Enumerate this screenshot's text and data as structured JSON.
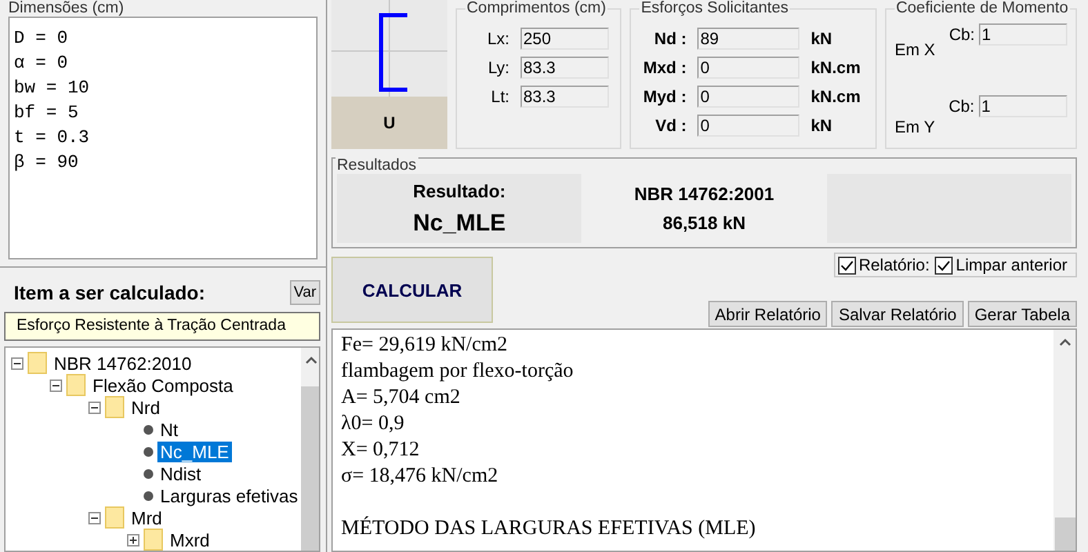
{
  "dimensions": {
    "title": "Dimensões (cm)",
    "lines": [
      "D = 0",
      "α = 0",
      "bw = 10",
      "bf = 5",
      "t = 0.3",
      "β = 90"
    ]
  },
  "item_panel": {
    "title": "Item a ser calculado:",
    "var_button": "Var",
    "description": "Esforço Resistente à Tração Centrada"
  },
  "tree": [
    {
      "label": "NBR 14762:2010",
      "kind": "folder",
      "expanded": true,
      "selected": false,
      "children": [
        {
          "label": "Flexão Composta",
          "kind": "folder",
          "expanded": true,
          "selected": false,
          "children": [
            {
              "label": "Nrd",
              "kind": "folder",
              "expanded": true,
              "selected": false,
              "children": [
                {
                  "label": "Nt",
                  "kind": "leaf",
                  "selected": false
                },
                {
                  "label": "Nc_MLE",
                  "kind": "leaf",
                  "selected": true
                },
                {
                  "label": "Ndist",
                  "kind": "leaf",
                  "selected": false
                },
                {
                  "label": "Larguras efetivas",
                  "kind": "leaf",
                  "selected": false
                }
              ]
            },
            {
              "label": "Mrd",
              "kind": "folder",
              "expanded": true,
              "selected": false,
              "children": [
                {
                  "label": "Mxrd",
                  "kind": "folder",
                  "expanded": false,
                  "selected": false
                }
              ]
            }
          ]
        }
      ]
    }
  ],
  "shape": {
    "label": "U"
  },
  "lengths": {
    "title": "Comprimentos (cm)",
    "fields": [
      {
        "label": "Lx:",
        "value": "250"
      },
      {
        "label": "Ly:",
        "value": "83.3"
      },
      {
        "label": "Lt:",
        "value": "83.3"
      }
    ]
  },
  "forces": {
    "title": "Esforços Solicitantes",
    "fields": [
      {
        "label": "Nd :",
        "value": "89",
        "unit": "kN"
      },
      {
        "label": "Mxd :",
        "value": "0",
        "unit": "kN.cm"
      },
      {
        "label": "Myd :",
        "value": "0",
        "unit": "kN.cm"
      },
      {
        "label": "Vd :",
        "value": "0",
        "unit": "kN"
      }
    ]
  },
  "moment": {
    "title": "Coeficiente de Momento",
    "rows": [
      {
        "axis": "Em X",
        "label": "Cb:",
        "value": "1"
      },
      {
        "axis": "Em Y",
        "label": "Cb:",
        "value": "1"
      }
    ]
  },
  "results": {
    "title": "Resultados",
    "label": "Resultado:",
    "item": "Nc_MLE",
    "norm": "NBR 14762:2001",
    "value": "86,518 kN"
  },
  "calculate_button": "CALCULAR",
  "options": [
    {
      "label": "Relatório:",
      "checked": true
    },
    {
      "label": "Limpar anterior",
      "checked": true
    }
  ],
  "buttons": [
    "Abrir Relatório",
    "Salvar Relatório",
    "Gerar Tabela"
  ],
  "report": {
    "paragraphs": [
      [
        "Fe= 29,619 kN/cm2",
        "flambagem por flexo-torção",
        "A= 5,704 cm2",
        "λ0= 0,9",
        "X= 0,712",
        "σ= 18,476 kN/cm2"
      ],
      [
        "MÉTODO DAS LARGURAS EFETIVAS (MLE)"
      ]
    ]
  }
}
